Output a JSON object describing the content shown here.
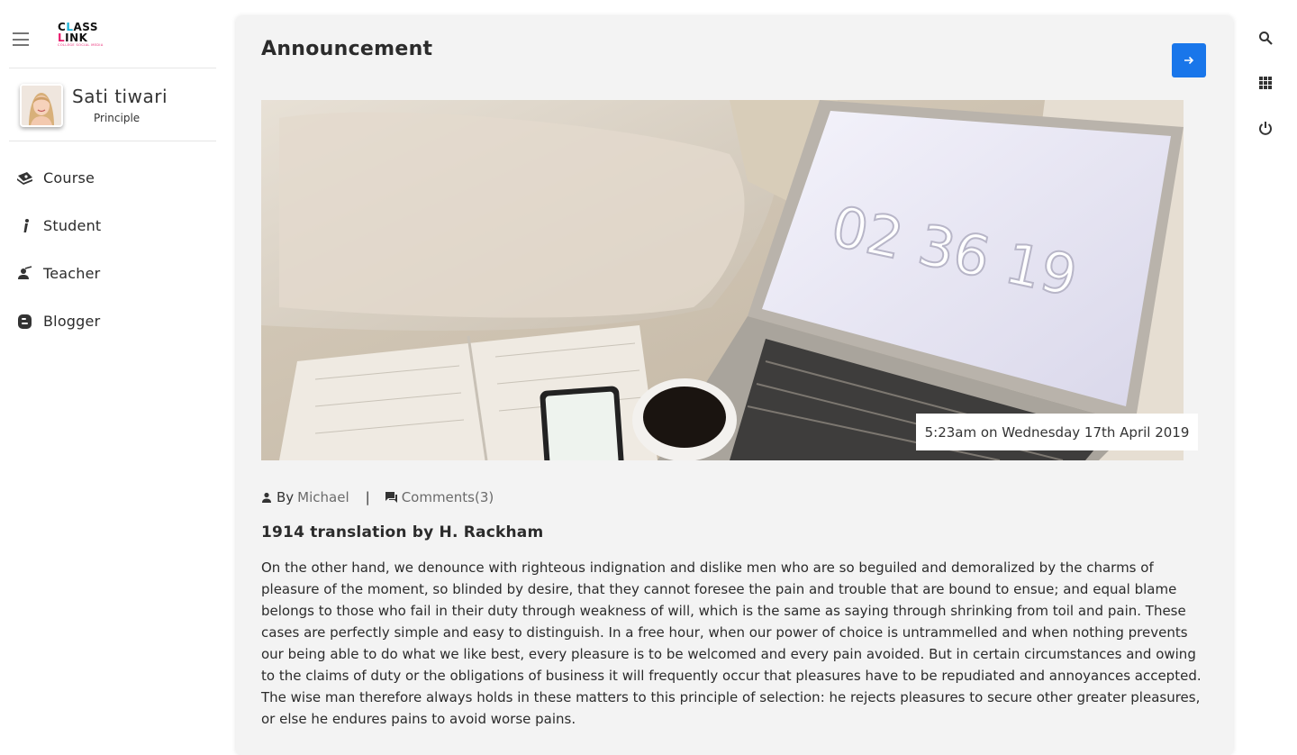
{
  "brand": {
    "line1": "CLASS",
    "line2": "LINK",
    "tagline": "COLLEGE SOCIAL MEDIA"
  },
  "profile": {
    "name": "Sati tiwari",
    "role": "Principle"
  },
  "sidebar": {
    "items": [
      {
        "label": "Course",
        "icon": "course-icon"
      },
      {
        "label": "Student",
        "icon": "student-icon"
      },
      {
        "label": "Teacher",
        "icon": "teacher-icon"
      },
      {
        "label": "Blogger",
        "icon": "blogger-icon"
      }
    ]
  },
  "announcement": {
    "title": "Announcement",
    "timestamp": "5:23am on Wednesday 17th April 2019",
    "by_prefix": "By",
    "author": "Michael",
    "separator": "|",
    "comments": "Comments(3)",
    "post_title": "1914 translation by H. Rackham",
    "body": "On the other hand, we denounce with righteous indignation and dislike men who are so beguiled and demoralized by the charms of pleasure of the moment, so blinded by desire, that they cannot foresee the pain and trouble that are bound to ensue; and equal blame belongs to those who fail in their duty through weakness of will, which is the same as saying through shrinking from toil and pain. These cases are perfectly simple and easy to distinguish. In a free hour, when our power of choice is untrammelled and when nothing prevents our being able to do what we like best, every pleasure is to be welcomed and every pain avoided. But in certain circumstances and owing to the claims of duty or the obligations of business it will frequently occur that pleasures have to be repudiated and annoyances accepted. The wise man therefore always holds in these matters to this principle of selection: he rejects pleasures to secure other greater pleasures, or else he endures pains to avoid worse pains."
  },
  "hero_clock_text": "02 36 19",
  "colors": {
    "accent": "#1976ea",
    "card_bg": "#f3f3f3",
    "brand_pink": "#e9196b",
    "brand_cyan": "#17b3d8"
  },
  "rail_icons": [
    "search-icon",
    "apps-grid-icon",
    "power-icon"
  ]
}
